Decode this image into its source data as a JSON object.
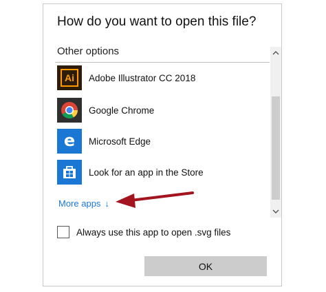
{
  "dialog": {
    "title": "How do you want to open this file?",
    "section_label": "Other options",
    "apps": [
      {
        "name": "Adobe Illustrator CC 2018",
        "icon": "adobe-illustrator-icon",
        "icon_text": "Ai",
        "color": "#2d1c0a"
      },
      {
        "name": "Google Chrome",
        "icon": "chrome-icon",
        "color": "#2f2f2f"
      },
      {
        "name": "Microsoft Edge",
        "icon": "edge-icon",
        "icon_text": "e",
        "color": "#1a78d4"
      },
      {
        "name": "Look for an app in the Store",
        "icon": "store-icon",
        "color": "#1a78d4"
      }
    ],
    "more_apps_label": "More apps",
    "more_apps_arrow": "↓",
    "checkbox_label": "Always use this app to open .svg files",
    "checkbox_checked": false,
    "ok_label": "OK"
  },
  "colors": {
    "accent": "#1a78d4",
    "annotation_arrow": "#a3141f"
  }
}
